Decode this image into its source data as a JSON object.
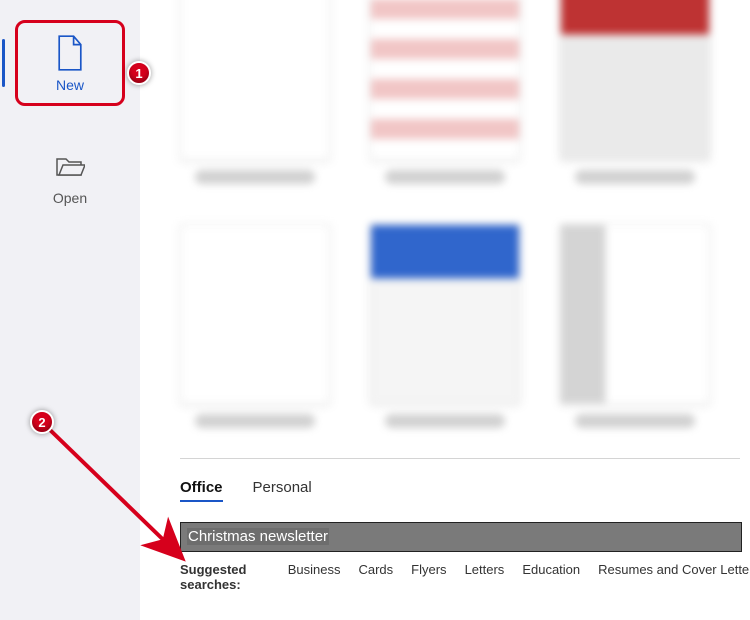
{
  "sidebar": {
    "new_label": "New",
    "open_label": "Open"
  },
  "tabs": {
    "office": "Office",
    "personal": "Personal"
  },
  "search": {
    "value": "Christmas newsletter"
  },
  "suggested": {
    "label": "Suggested searches:",
    "terms": [
      "Business",
      "Cards",
      "Flyers",
      "Letters",
      "Education",
      "Resumes and Cover Letters"
    ]
  },
  "annotations": {
    "c1": "1",
    "c2": "2"
  }
}
